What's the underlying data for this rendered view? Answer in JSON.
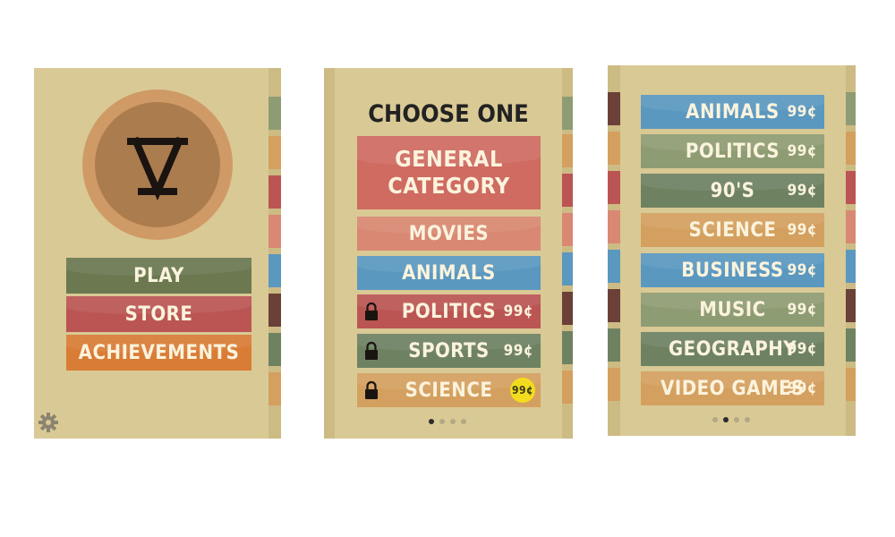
{
  "colors": {
    "screen_bg": "#d9c995",
    "logo_outer": "#cf9a66",
    "logo_inner": "#ab7c4e",
    "olive": "#6b7850",
    "red": "#bb5553",
    "orange": "#d97c36",
    "salmon": "#cf6b61",
    "peach": "#d98873",
    "blue": "#5a98c0",
    "sage": "#8e9c74",
    "green": "#6e8262",
    "tan": "#d4a05f",
    "badge_yellow": "#f3dc1f"
  },
  "screen1": {
    "menu": [
      {
        "label": "PLAY"
      },
      {
        "label": "STORE"
      },
      {
        "label": "ACHIEVEMENTS"
      }
    ],
    "settings_icon": "gear-icon"
  },
  "screen2": {
    "heading": "CHOOSE ONE",
    "general_category": "GENERAL CATEGORY",
    "categories": [
      {
        "label": "MOVIES",
        "price": "",
        "locked": false
      },
      {
        "label": "ANIMALS",
        "price": "",
        "locked": false
      },
      {
        "label": "POLITICS",
        "price": "99¢",
        "locked": true
      },
      {
        "label": "SPORTS",
        "price": "99¢",
        "locked": true
      },
      {
        "label": "SCIENCE",
        "price": "99¢",
        "locked": true
      }
    ],
    "page_indicator": {
      "total": 4,
      "current": 1
    }
  },
  "screen3": {
    "categories": [
      {
        "label": "ANIMALS",
        "price": "99¢"
      },
      {
        "label": "POLITICS",
        "price": "99¢"
      },
      {
        "label": "90'S",
        "price": "99¢"
      },
      {
        "label": "SCIENCE",
        "price": "99¢"
      },
      {
        "label": "BUSINESS",
        "price": "99¢"
      },
      {
        "label": "MUSIC",
        "price": "99¢"
      },
      {
        "label": "GEOGRAPHY",
        "price": "99¢"
      },
      {
        "label": "VIDEO GAMES",
        "price": "99¢"
      }
    ],
    "page_indicator": {
      "total": 4,
      "current": 2
    }
  }
}
